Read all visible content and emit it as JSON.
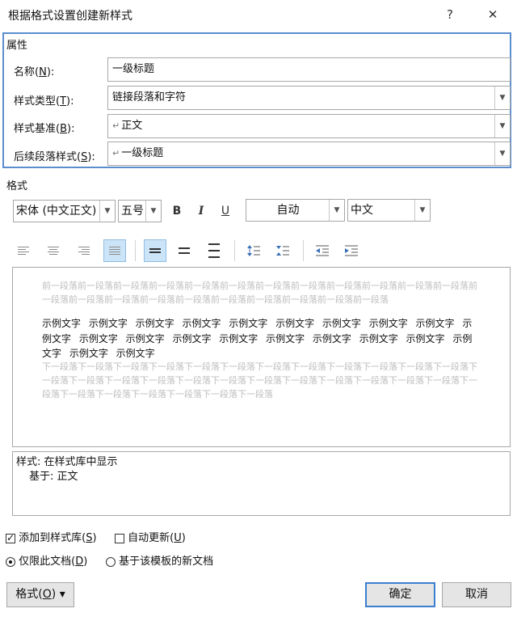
{
  "window": {
    "title": "根据格式设置创建新样式",
    "help": "?",
    "close": "✕"
  },
  "properties": {
    "section": "属性",
    "name": {
      "label": "名称(",
      "key": "N",
      "end": "):",
      "value": "一级标题"
    },
    "style_type": {
      "label": "样式类型(",
      "key": "T",
      "end": "):",
      "value": "链接段落和字符"
    },
    "based_on": {
      "label": "样式基准(",
      "key": "B",
      "end": "):",
      "value": "正文",
      "mark": "↵"
    },
    "next_style": {
      "label": "后续段落样式(",
      "key": "S",
      "end": "):",
      "value": "一级标题",
      "mark": "↵"
    }
  },
  "format": {
    "section": "格式",
    "font": "宋体 (中文正文)",
    "size": "五号",
    "bold": "B",
    "italic": "I",
    "underline": "U",
    "color": "自动",
    "lang": "中文"
  },
  "preview": {
    "prev_para": "前一段落前一段落前一段落前一段落前一段落前一段落前一段落前一段落前一段落前一段落前一段落前一段落前一段落前一段落前一段落前一段落前一段落前一段落前一段落前一段落前一段落前一段落",
    "sample": "示例文字 示例文字 示例文字 示例文字 示例文字 示例文字 示例文字 示例文字 示例文字 示例文字 示例文字 示例文字 示例文字 示例文字 示例文字 示例文字 示例文字 示例文字 示例文字 示例文字 示例文字",
    "next_para": "下一段落下一段落下一段落下一段落下一段落下一段落下一段落下一段落下一段落下一段落下一段落下一段落下一段落下一段落下一段落下一段落下一段落下一段落下一段落下一段落下一段落下一段落下一段落下一段落下一段落下一段落下一段落下一段落下一段落下一段落下一段落"
  },
  "description": {
    "line1": "样式: 在样式库中显示",
    "line2": "基于: 正文"
  },
  "options": {
    "add_gallery": {
      "label": "添加到样式库(",
      "key": "S",
      "end": ")",
      "checked": true
    },
    "auto_update": {
      "label": "自动更新(",
      "key": "U",
      "end": ")",
      "checked": false
    },
    "this_doc": {
      "label": "仅限此文档(",
      "key": "D",
      "end": ")",
      "selected": true
    },
    "new_docs": {
      "label": "基于该模板的新文档",
      "selected": false
    }
  },
  "buttons": {
    "format": {
      "label": "格式(",
      "key": "O",
      "end": ")",
      "arrow": "▾"
    },
    "ok": "确定",
    "cancel": "取消"
  },
  "colors": {
    "accent_border": "#5b8ecf",
    "primary_border": "#3c7fd0",
    "active_bg": "#cce4f7"
  }
}
